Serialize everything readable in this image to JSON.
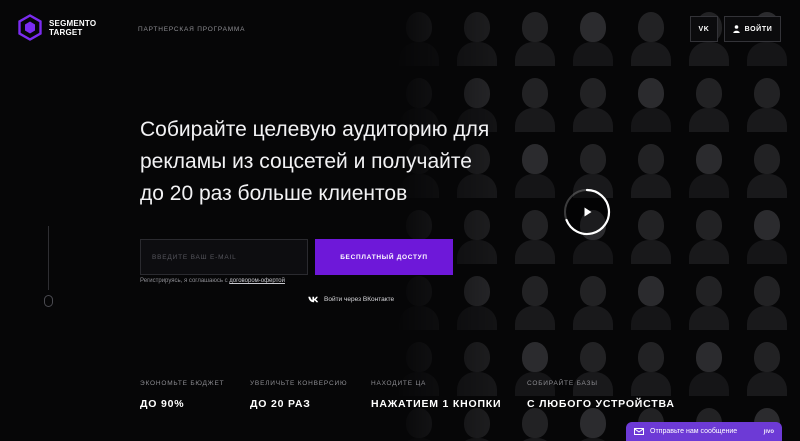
{
  "header": {
    "logo_line1": "SEGMENTO",
    "logo_line2": "TARGET",
    "partner_program": "ПАРТНЕРСКАЯ ПРОГРАММА",
    "vk_label": "VK",
    "login_label": "ВОЙТИ"
  },
  "hero": {
    "title_line1": "Собирайте целевую аудиторию для",
    "title_line2": "рекламы из соцсетей и получайте",
    "title_line3": "до 20 раз больше клиентов",
    "email_placeholder": "ВВЕДИТЕ ВАШ E-MAIL",
    "cta_label": "БЕСПЛАТНЫЙ ДОСТУП",
    "agree_text": "Регистрируясь, я соглашаюсь с ",
    "agree_link": "договором-офертой",
    "vk_login": "Войти через ВКонтакте"
  },
  "features": [
    {
      "label": "ЭКОНОМЬТЕ БЮДЖЕТ",
      "value": "ДО 90%"
    },
    {
      "label": "УВЕЛИЧЬТЕ КОНВЕРСИЮ",
      "value": "ДО 20 РАЗ"
    },
    {
      "label": "НАХОДИТЕ ЦА",
      "value": "НАЖАТИЕМ 1 КНОПКИ"
    },
    {
      "label": "СОБИРАЙТЕ БАЗЫ",
      "value": "С ЛЮБОГО УСТРОЙСТВА"
    }
  ],
  "chat": {
    "label": "Отправьте нам сообщение",
    "brand": "jivo"
  },
  "colors": {
    "accent": "#6e18d9",
    "chat": "#6d3ad6",
    "background": "#060607"
  },
  "icons": [
    "logo-hexagon-icon",
    "vk-icon",
    "user-icon",
    "play-icon",
    "mail-icon",
    "mouse-scroll-icon"
  ]
}
